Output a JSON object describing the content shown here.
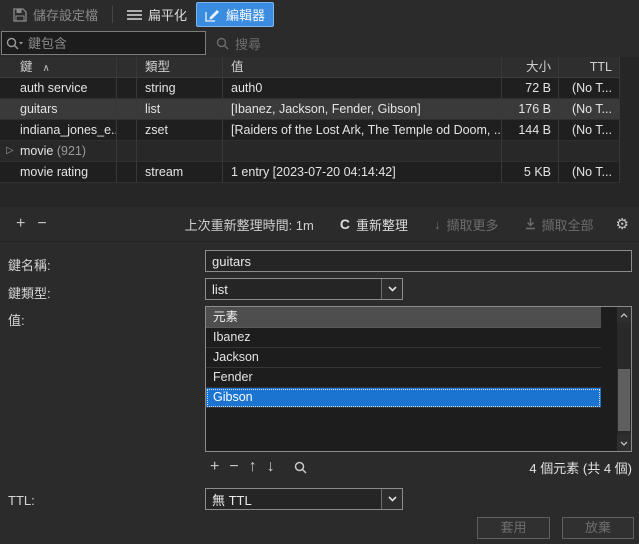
{
  "toolbar": {
    "save_label": "儲存設定檔",
    "flatten_label": "扁平化",
    "editor_label": "編輯器"
  },
  "search": {
    "placeholder": "鍵包含",
    "button_label": "搜尋"
  },
  "key_table": {
    "columns": {
      "key": "鍵",
      "type": "類型",
      "value": "值",
      "size": "大小",
      "ttl": "TTL"
    },
    "rows": [
      {
        "key": "auth service",
        "count": "",
        "type": "string",
        "value": "auth0",
        "size": "72 B",
        "ttl": "(No T..."
      },
      {
        "key": "guitars",
        "count": "",
        "type": "list",
        "value": "[Ibanez, Jackson, Fender, Gibson]",
        "size": "176 B",
        "ttl": "(No T..."
      },
      {
        "key": "indiana_jones_e...",
        "count": "",
        "type": "zset",
        "value": "[Raiders of the Lost Ark, The Temple od Doom, ...",
        "size": "144 B",
        "ttl": "(No T..."
      },
      {
        "key": "movie",
        "count": "(921)",
        "type": "",
        "value": "",
        "size": "",
        "ttl": ""
      },
      {
        "key": "movie rating",
        "count": "",
        "type": "stream",
        "value": "1 entry [2023-07-20 04:14:42]",
        "size": "5 KB",
        "ttl": "(No T..."
      }
    ]
  },
  "tree_toolbar": {
    "last_refresh_text": "上次重新整理時間: 1m",
    "refresh_label": "重新整理",
    "fetch_more_label": "擷取更多",
    "fetch_all_label": "擷取全部"
  },
  "editor": {
    "key_name_label": "鍵名稱:",
    "key_name_value": "guitars",
    "key_type_label": "鍵類型:",
    "key_type_value": "list",
    "value_label": "值:",
    "value_list": {
      "column_header": "元素",
      "items": [
        "Ibanez",
        "Jackson",
        "Fender",
        "Gibson"
      ],
      "selected_index": 3,
      "count_text": "4 個元素 (共 4 個)"
    },
    "ttl_label": "TTL:",
    "ttl_value": "無 TTL",
    "apply_label": "套用",
    "discard_label": "放棄"
  },
  "icons": {
    "sort_asc": "∧",
    "expand": "▷",
    "plus": "+",
    "minus": "−",
    "arrow_up": "↑",
    "arrow_down": "↓",
    "refresh_c": "C",
    "gear": "⚙"
  },
  "colors": {
    "accent_blue": "#3a8ce0",
    "selection_blue": "#1b74cf",
    "background": "#2b2b2b"
  }
}
